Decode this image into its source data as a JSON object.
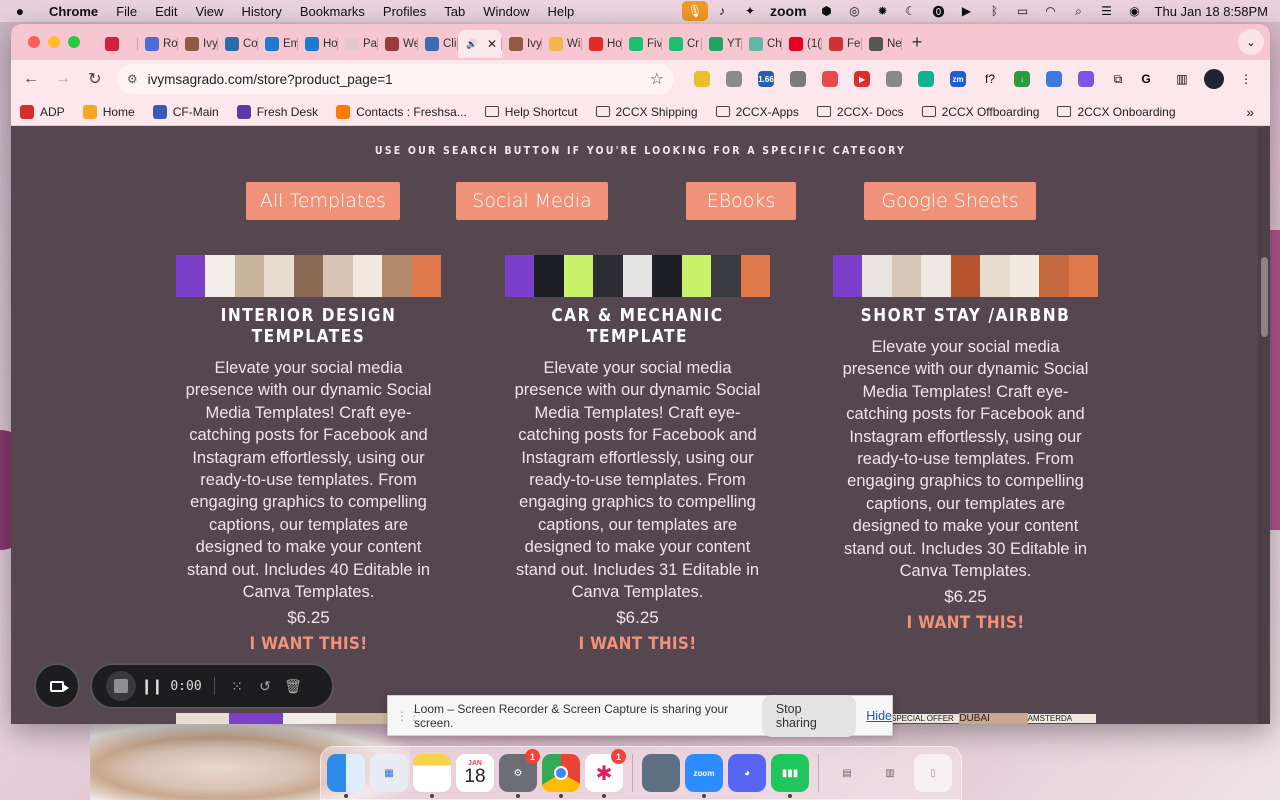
{
  "menubar": {
    "app": "Chrome",
    "menus": [
      "File",
      "Edit",
      "View",
      "History",
      "Bookmarks",
      "Profiles",
      "Tab",
      "Window",
      "Help"
    ],
    "zoom": "zoom",
    "datetime": "Thu Jan 18  8:58PM"
  },
  "tabs": [
    {
      "label": "",
      "color": "#d3203f",
      "icon": "record-icon"
    },
    {
      "label": "Ro",
      "color": "#4f6bd9",
      "icon": "bot-icon"
    },
    {
      "label": "Ivy",
      "color": "#8e5a46",
      "icon": "site-icon"
    },
    {
      "label": "Co",
      "color": "#2a6fab",
      "icon": "wordpress-icon"
    },
    {
      "label": "Em",
      "color": "#1b7cd0",
      "icon": "email-icon"
    },
    {
      "label": "Ho",
      "color": "#1b7cd0",
      "icon": "home-icon"
    },
    {
      "label": "Pa",
      "color": "#e5c7cf",
      "icon": "page-icon"
    },
    {
      "label": "We",
      "color": "#9b3a3a",
      "icon": "calendar-icon"
    },
    {
      "label": "Cli",
      "color": "#3b6bb5",
      "icon": "clickup-icon"
    },
    {
      "label": "",
      "color": "#fce8ec",
      "icon": "audio-icon",
      "active": true
    },
    {
      "label": "Ivy",
      "color": "#8e5a46",
      "icon": "site-icon"
    },
    {
      "label": "Wi",
      "color": "#f0b64a",
      "icon": "circle-icon"
    },
    {
      "label": "Ho",
      "color": "#e02b2b",
      "icon": "youtube-icon"
    },
    {
      "label": "Fiv",
      "color": "#1dbf73",
      "icon": "fiverr-icon"
    },
    {
      "label": "Cr",
      "color": "#1dbf73",
      "icon": "fiverr-icon"
    },
    {
      "label": "YT",
      "color": "#1fa463",
      "icon": "sheets-icon"
    },
    {
      "label": "Ch",
      "color": "#5fb8a7",
      "icon": "chatgpt-icon"
    },
    {
      "label": "(1(",
      "color": "#e60023",
      "icon": "pinterest-icon"
    },
    {
      "label": "Fe",
      "color": "#c33",
      "icon": "site-icon"
    },
    {
      "label": "Ne",
      "color": "#555",
      "icon": "browser-icon"
    }
  ],
  "address": {
    "url": "ivymsagrado.com/store?product_page=1"
  },
  "bookmarks": [
    {
      "label": "ADP",
      "type": "site"
    },
    {
      "label": "Home",
      "type": "site"
    },
    {
      "label": "CF-Main",
      "type": "site"
    },
    {
      "label": "Fresh Desk",
      "type": "site"
    },
    {
      "label": "Contacts : Freshsa...",
      "type": "site"
    },
    {
      "label": "Help Shortcut",
      "type": "folder"
    },
    {
      "label": "2CCX Shipping",
      "type": "folder"
    },
    {
      "label": "2CCX-Apps",
      "type": "folder"
    },
    {
      "label": "2CCX- Docs",
      "type": "folder"
    },
    {
      "label": "2CCX Offboarding",
      "type": "folder"
    },
    {
      "label": "2CCX Onboarding",
      "type": "folder"
    }
  ],
  "page": {
    "hint": "USE OUR SEARCH BUTTON IF YOU'RE LOOKING FOR A SPECIFIC CATEGORY",
    "categories": [
      "All Templates",
      "Social Media",
      "EBooks",
      "Google Sheets"
    ],
    "products": [
      {
        "title": "INTERIOR DESIGN TEMPLATES",
        "description": "Elevate your social media presence with our dynamic Social Media Templates! Craft eye-catching posts for Facebook and Instagram effortlessly, using our ready-to-use templates. From engaging graphics to compelling captions, our templates are designed to make your content stand out. Includes 40 Editable in Canva Templates.",
        "price": "$6.25",
        "cta": "I WANT THIS!"
      },
      {
        "title": "CAR & MECHANIC TEMPLATE",
        "description": "Elevate your social media presence with our dynamic Social Media Templates! Craft eye-catching posts for Facebook and Instagram effortlessly, using our ready-to-use templates. From engaging graphics to compelling captions, our templates are designed to make your content stand out. Includes 31 Editable in Canva Templates.",
        "price": "$6.25",
        "cta": "I WANT THIS!"
      },
      {
        "title": "SHORT STAY /AIRBNB",
        "description": "Elevate your social media presence with our dynamic Social Media Templates! Craft eye-catching posts for Facebook and Instagram effortlessly, using our ready-to-use templates. From engaging graphics to compelling captions, our templates are designed to make your content stand out. Includes 30 Editable in Canva Templates.",
        "price": "$6.25",
        "cta": "I WANT THIS!"
      }
    ],
    "next_row_thumb_texts": [
      "SPECIAL OFFER",
      "DUBAI",
      "AMSTERDA"
    ]
  },
  "loom": {
    "time": "0:00",
    "banner_text": "Loom – Screen Recorder & Screen Capture is sharing your screen.",
    "stop_label": "Stop sharing",
    "hide_label": "Hide"
  },
  "dock": {
    "calendar_month": "JAN",
    "calendar_day": "18",
    "badges": {
      "settings": "1",
      "slack": "1"
    }
  },
  "colors": {
    "page_bg": "#55464f",
    "accent": "#f0917a",
    "tab_strip": "#f6c7d0"
  }
}
